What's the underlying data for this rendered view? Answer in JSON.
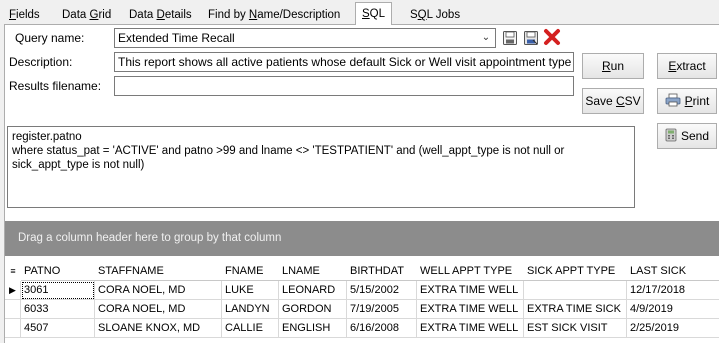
{
  "tabs": [
    {
      "pre": "",
      "u": "F",
      "post": "ields"
    },
    {
      "pre": "Data ",
      "u": "G",
      "post": "rid"
    },
    {
      "pre": "Data ",
      "u": "D",
      "post": "etails"
    },
    {
      "pre": "Find by ",
      "u": "N",
      "post": "ame/Description"
    },
    {
      "pre": "",
      "u": "S",
      "post": "QL"
    },
    {
      "pre": "S",
      "u": "Q",
      "post": "L Jobs"
    }
  ],
  "active_tab": "SQL",
  "form": {
    "query_name_label": "Query name:",
    "query_name_value": "Extended Time Recall",
    "description_label": "Description:",
    "description_value": "This report shows all active patients whose default Sick or Well visit appointment type",
    "results_label": "Results filename:",
    "results_value": ""
  },
  "buttons": {
    "run": {
      "pre": "",
      "u": "R",
      "post": "un"
    },
    "extract": {
      "pre": "",
      "u": "E",
      "post": "xtract"
    },
    "save_csv": {
      "pre": "Save ",
      "u": "C",
      "post": "SV"
    },
    "print": {
      "pre": "",
      "u": "P",
      "post": "rint"
    },
    "send": "Send"
  },
  "icons": {
    "save": "save-icon",
    "save_as": "save-as-icon",
    "delete": "delete-icon",
    "print": "printer-icon",
    "send": "send-icon"
  },
  "sql": {
    "lines": [
      "register.patno",
      "where status_pat = 'ACTIVE' and patno >99 and lname <> 'TESTPATIENT' and (well_appt_type is not null or",
      "sick_appt_type is not null)"
    ]
  },
  "grid": {
    "group_hint": "Drag a column header here to group by that column",
    "columns": [
      "PATNO",
      "STAFFNAME",
      "FNAME",
      "LNAME",
      "BIRTHDAT",
      "WELL APPT TYPE",
      "SICK APPT TYPE",
      "LAST SICK"
    ],
    "rows": [
      [
        "3061",
        "CORA NOEL, MD",
        "LUKE",
        "LEONARD",
        "5/15/2002",
        "EXTRA TIME WELL",
        "",
        "12/17/2018"
      ],
      [
        "6033",
        "CORA NOEL, MD",
        "LANDYN",
        "GORDON",
        "7/19/2005",
        "EXTRA TIME WELL",
        "EXTRA TIME SICK",
        "4/9/2019"
      ],
      [
        "4507",
        "SLOANE KNOX, MD",
        "CALLIE",
        "ENGLISH",
        "6/16/2008",
        "EXTRA TIME WELL",
        "EST SICK VISIT",
        "2/25/2019"
      ]
    ],
    "selected_row": 0
  },
  "colors": {
    "delete_red": "#d42020",
    "group_bar": "#8c8c8c",
    "save_blue": "#3a5fa8"
  }
}
